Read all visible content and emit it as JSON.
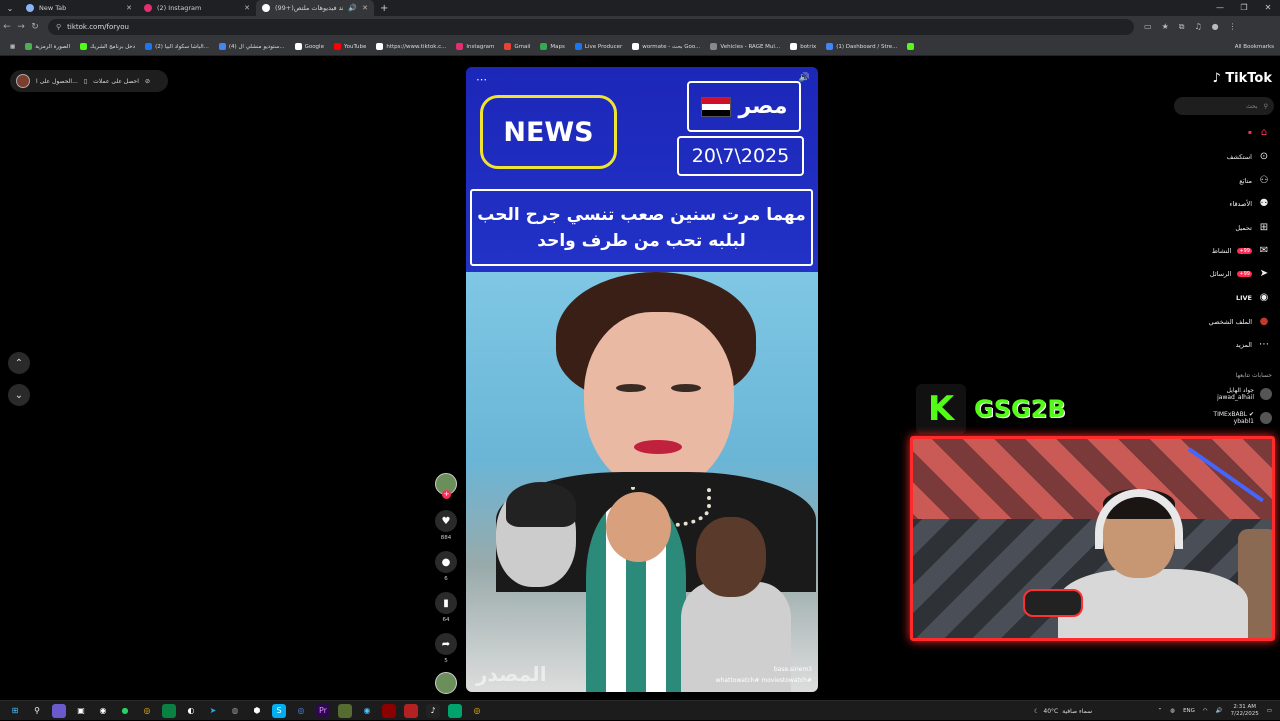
{
  "browser": {
    "tabs": [
      {
        "label": "New Tab",
        "color": "#8ab4f8"
      },
      {
        "label": "(2) Instagram",
        "color": "#e1306c"
      },
      {
        "label": "(99+)شاهد فيديوهات ملتص...",
        "color": "#ffffff"
      }
    ],
    "url": "tiktok.com/foryou",
    "bookmarks": [
      {
        "label": "الصورة الرمزية",
        "color": "#4caf50"
      },
      {
        "label": "دخل برنامج الشريك",
        "color": "#53fc18"
      },
      {
        "label": "(2) الباشا سكواد البيا...",
        "color": "#1877f2"
      },
      {
        "label": "(4) ستوديو منشلي ال...",
        "color": "#4285f4"
      },
      {
        "label": "Google",
        "color": "#ffffff"
      },
      {
        "label": "YouTube",
        "color": "#ff0000"
      },
      {
        "label": "https://www.tiktok.c...",
        "color": "#ffffff"
      },
      {
        "label": "Instagram",
        "color": "#e1306c"
      },
      {
        "label": "Gmail",
        "color": "#ea4335"
      },
      {
        "label": "Maps",
        "color": "#34a853"
      },
      {
        "label": "Live Producer",
        "color": "#1877f2"
      },
      {
        "label": "wormate - بحث Goo...",
        "color": "#ffffff"
      },
      {
        "label": "Vehicles - RAGE Mul...",
        "color": "#888888"
      },
      {
        "label": "botrix",
        "color": "#ffffff"
      },
      {
        "label": "(1) Dashboard / Stre...",
        "color": "#4285f4"
      }
    ],
    "all_bookmarks": "All Bookmarks"
  },
  "page": {
    "get_app": "احصل على عملات",
    "get_app2": "الحصول على ا..."
  },
  "video": {
    "news": "NEWS",
    "country": "مصر",
    "date": "20\\7\\2025",
    "line1": "مهما مرت سنين صعب تنسي جرح الحب",
    "line2": "لبلبه تحب من طرف واحد",
    "watermark": "المصدر",
    "handle1": "base.sinem3",
    "handle2": "whattowatch# moviestowatch#"
  },
  "actions": {
    "likes": "884",
    "comments": "6",
    "saves": "64",
    "shares": "5"
  },
  "sidebar": {
    "logo": "TikTok",
    "search_placeholder": "بحث",
    "items": [
      {
        "label": "استكشف",
        "icon": "compass-icon",
        "glyph": "⊙"
      },
      {
        "label": "متابَع",
        "icon": "following-icon",
        "glyph": "⚇"
      },
      {
        "label": "الأصدقاء",
        "icon": "friends-icon",
        "glyph": "⚉"
      },
      {
        "label": "تحميل",
        "icon": "upload-icon",
        "glyph": "⊞"
      },
      {
        "label": "النشاط",
        "icon": "activity-icon",
        "glyph": "✉",
        "badge": "99+"
      },
      {
        "label": "الرسائل",
        "icon": "messages-icon",
        "glyph": "➤",
        "badge": "99+"
      },
      {
        "label": "LIVE",
        "icon": "live-icon",
        "glyph": "◉"
      },
      {
        "label": "الملف الشخصي",
        "icon": "profile-icon",
        "glyph": "●"
      },
      {
        "label": "المزيد",
        "icon": "more-icon",
        "glyph": "⋯"
      }
    ],
    "following_header": "حسابات تتابعها",
    "following": [
      {
        "name": "جواد الهايل",
        "handle": "jawad_alhail"
      },
      {
        "name": "TIMExBABL ✔",
        "handle": "ybabl1"
      }
    ]
  },
  "stream": {
    "kick_letter": "K",
    "channel": "GSG2B"
  },
  "taskbar": {
    "weather_temp": "40°C",
    "weather_text": "سماء صافية",
    "lang": "ENG",
    "time": "2:31 AM",
    "date": "7/22/2025"
  }
}
